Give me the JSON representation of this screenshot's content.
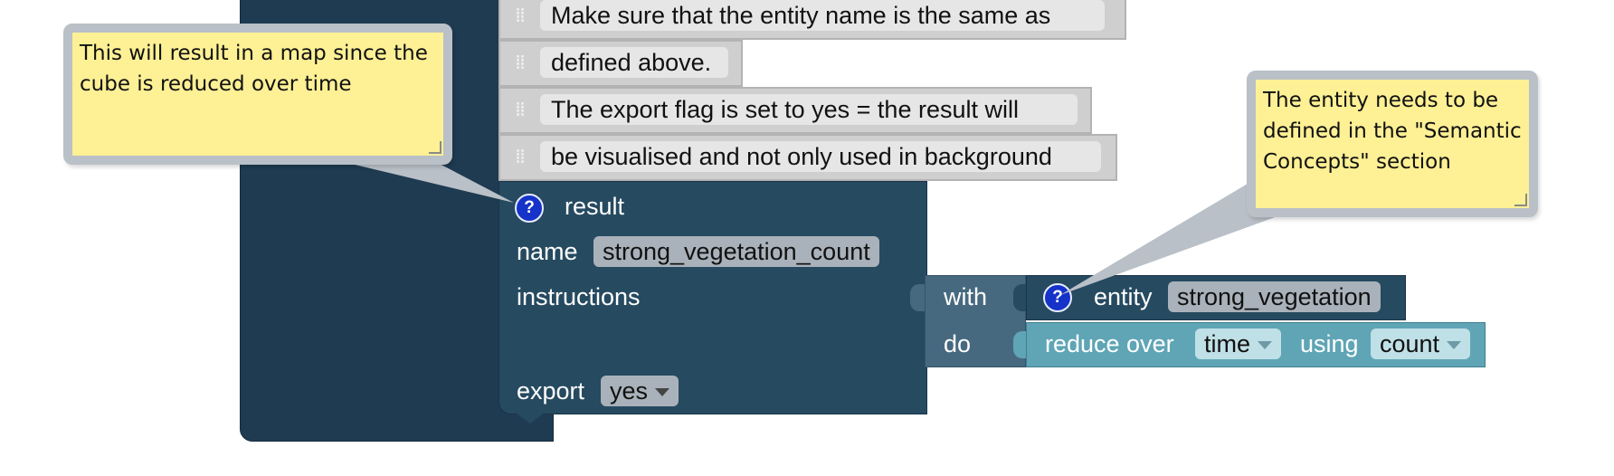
{
  "comments": [
    "Make sure that the entity name is the same as",
    "defined above.",
    "The export flag is set to yes = the result will",
    "be visualised and not only used in background"
  ],
  "result_block": {
    "title": "result",
    "name_label": "name",
    "name_value": "strong_vegetation_count",
    "instructions_label": "instructions",
    "export_label": "export",
    "export_value": "yes"
  },
  "with_block": {
    "with_label": "with",
    "do_label": "do"
  },
  "entity_block": {
    "label": "entity",
    "value": "strong_vegetation"
  },
  "reduce_block": {
    "label": "reduce over",
    "dimension": "time",
    "using_label": "using",
    "reducer": "count"
  },
  "tooltips": {
    "result_help": "This will result in a map since the cube is reduced over time",
    "entity_help": "The entity needs to be defined in the \"Semantic Concepts\" section"
  },
  "help_icon_glyph": "?",
  "colors": {
    "dark_block": "#1e3b52",
    "result_block": "#264a60",
    "with_block": "#47697f",
    "reduce_block": "#5fa5b5",
    "tooltip_bg": "#fdf095",
    "help_icon": "#1533c9"
  }
}
